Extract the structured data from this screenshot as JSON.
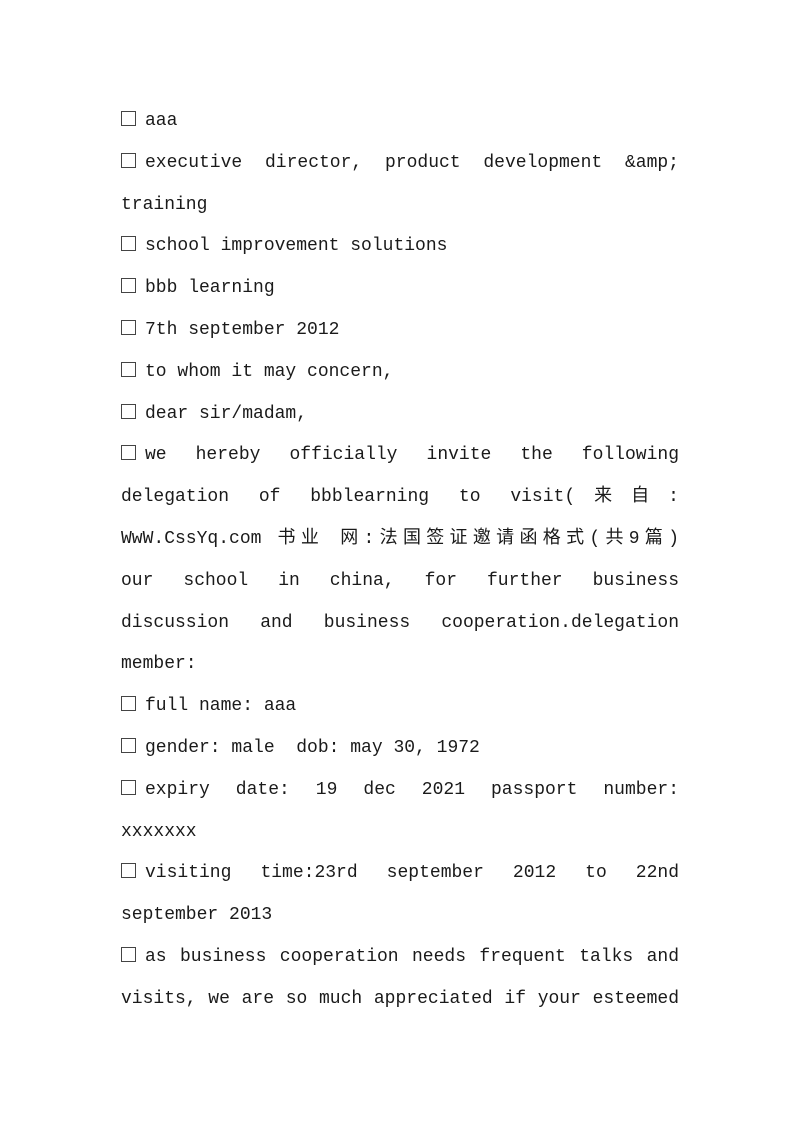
{
  "document": {
    "paragraphs": [
      {
        "lines": [
          "aaa"
        ],
        "checkbox": true
      },
      {
        "lines": [
          "executive director, product development &amp;",
          "training"
        ],
        "checkbox": true
      },
      {
        "lines": [
          "school improvement solutions"
        ],
        "checkbox": true
      },
      {
        "lines": [
          "bbb learning"
        ],
        "checkbox": true
      },
      {
        "lines": [
          "7th september 2012"
        ],
        "checkbox": true
      },
      {
        "lines": [
          "to whom it may concern,"
        ],
        "checkbox": true
      },
      {
        "lines": [
          "dear sir/madam,"
        ],
        "checkbox": true
      },
      {
        "lines": [
          "we hereby officially invite the following",
          "delegation of bbblearning to visit(来自:",
          "WwW.CssYq.com 书业 网:法国签证邀请函格式(共9篇)",
          "our school in china, for further business",
          "discussion and business cooperation.delegation",
          "member:"
        ],
        "checkbox": true
      },
      {
        "lines": [
          "full name: aaa"
        ],
        "checkbox": true
      },
      {
        "lines": [
          "gender: male  dob: may 30, 1972"
        ],
        "checkbox": true
      },
      {
        "lines": [
          "expiry date: 19 dec 2021 passport number:",
          "xxxxxxx"
        ],
        "checkbox": true
      },
      {
        "lines": [
          "visiting time:23rd september 2012 to 22nd",
          "september 2013"
        ],
        "checkbox": true
      },
      {
        "lines": [
          "as business cooperation needs frequent talks and",
          "visits, we are so much appreciated if your esteemed"
        ],
        "checkbox": true
      }
    ]
  }
}
